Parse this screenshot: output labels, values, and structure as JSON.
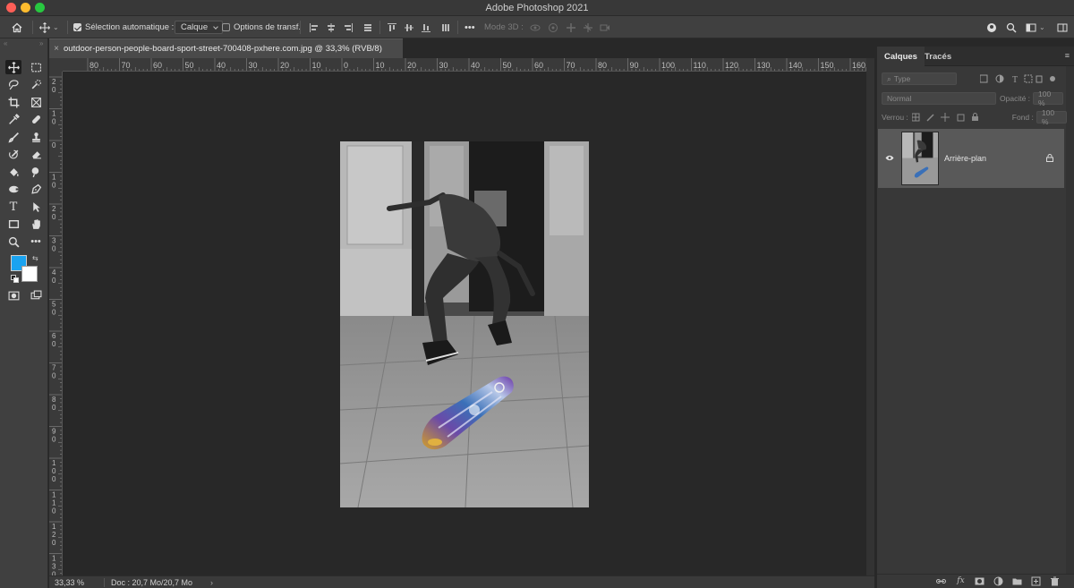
{
  "window": {
    "title": "Adobe Photoshop 2021"
  },
  "options_bar": {
    "auto_select_label": "Sélection automatique :",
    "auto_select_checked": true,
    "auto_select_value": "Calque",
    "transform_label": "Options de transf.",
    "transform_checked": false,
    "more": "•••",
    "mode3d_label": "Mode 3D :"
  },
  "document_tab": {
    "close": "×",
    "title": "outdoor-person-people-board-sport-street-700408-pxhere.com.jpg @ 33,3% (RVB/8)"
  },
  "rulers": {
    "horizontal": [
      "80",
      "70",
      "60",
      "50",
      "40",
      "30",
      "20",
      "10",
      "0",
      "10",
      "20",
      "30",
      "40",
      "50",
      "60",
      "70",
      "80",
      "90",
      "100",
      "110",
      "120",
      "130",
      "140",
      "150",
      "160"
    ],
    "vertical": [
      "2\n0",
      "1\n0",
      "0",
      "1\n0",
      "2\n0",
      "3\n0",
      "4\n0",
      "5\n0",
      "6\n0",
      "7\n0",
      "8\n0",
      "9\n0",
      "1\n0\n0",
      "1\n1\n0",
      "1\n2\n0",
      "1\n3\n0"
    ]
  },
  "status_bar": {
    "zoom": "33,33 %",
    "doc_info": "Doc : 20,7 Mo/20,7 Mo",
    "arrow": "›"
  },
  "colors": {
    "foreground": "#1aa3f0",
    "background": "#ffffff"
  },
  "layers_panel": {
    "tabs": [
      "Calques",
      "Tracés"
    ],
    "active_tab": "Calques",
    "filter_placeholder": "Type",
    "blend_mode": "Normal",
    "opacity_label": "Opacité :",
    "opacity_value": "100 %",
    "lock_label": "Verrou :",
    "fill_label": "Fond :",
    "fill_value": "100 %",
    "layers": [
      {
        "name": "Arrière-plan",
        "visible": true,
        "locked": true
      }
    ],
    "footer_icons": [
      "link-icon",
      "fx-icon",
      "mask-icon",
      "adjustment-icon",
      "folder-icon",
      "new-layer-icon",
      "trash-icon"
    ],
    "fx_label": "fx"
  }
}
